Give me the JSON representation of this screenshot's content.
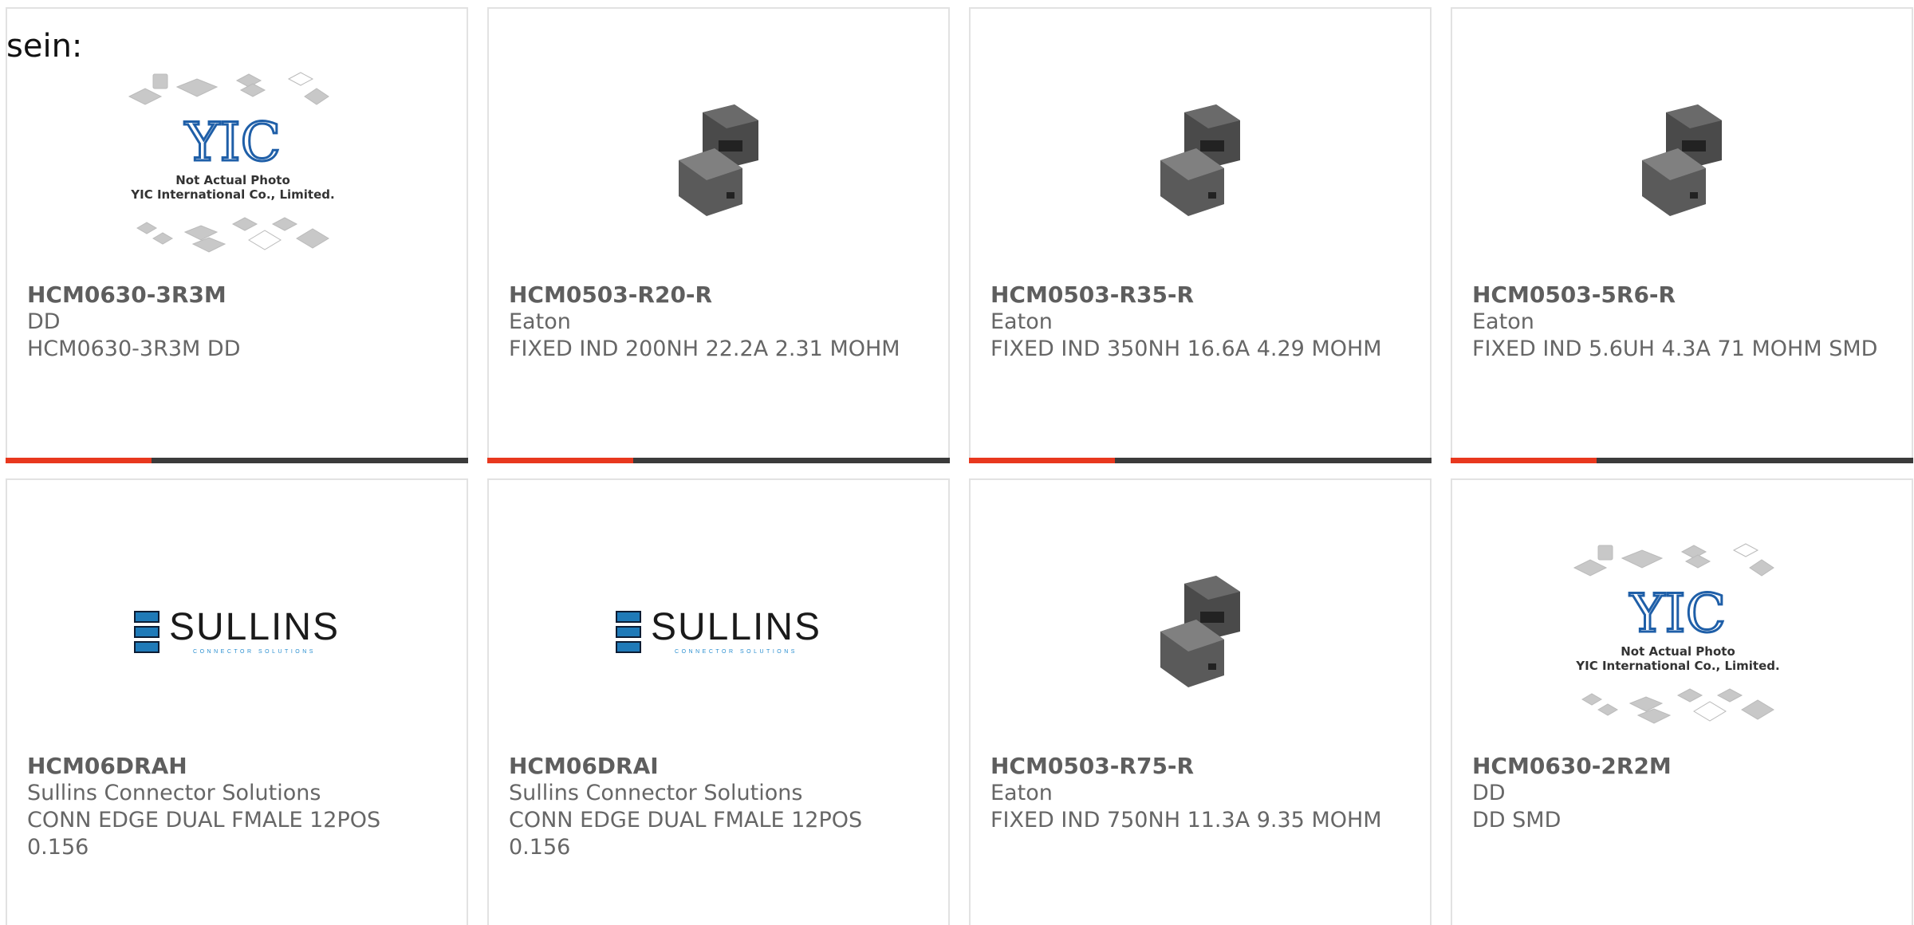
{
  "overlay_text": "sein:",
  "colors": {
    "accent": "#e8381e",
    "bar": "#3b3b3b",
    "card_border": "#e2e2e2",
    "text": "#666666"
  },
  "placeholder": {
    "line1": "Not Actual Photo",
    "line2": "YIC International Co., Limited.",
    "logo": "YIC"
  },
  "sullins_logo": {
    "name": "SULLINS",
    "tagline": "CONNECTOR SOLUTIONS"
  },
  "products": [
    {
      "part": "HCM0630-3R3M",
      "manufacturer": "DD",
      "description": "HCM0630-3R3M DD",
      "image": "yic-placeholder"
    },
    {
      "part": "HCM0503-R20-R",
      "manufacturer": "Eaton",
      "description": "FIXED IND 200NH 22.2A 2.31 MOHM",
      "image": "inductor-photo"
    },
    {
      "part": "HCM0503-R35-R",
      "manufacturer": "Eaton",
      "description": "FIXED IND 350NH 16.6A 4.29 MOHM",
      "image": "inductor-photo"
    },
    {
      "part": "HCM0503-5R6-R",
      "manufacturer": "Eaton",
      "description": "FIXED IND 5.6UH 4.3A 71 MOHM SMD",
      "image": "inductor-photo"
    },
    {
      "part": "HCM06DRAH",
      "manufacturer": "Sullins Connector Solutions",
      "description": "CONN EDGE DUAL FMALE 12POS 0.156",
      "image": "sullins-logo"
    },
    {
      "part": "HCM06DRAI",
      "manufacturer": "Sullins Connector Solutions",
      "description": "CONN EDGE DUAL FMALE 12POS 0.156",
      "image": "sullins-logo"
    },
    {
      "part": "HCM0503-R75-R",
      "manufacturer": "Eaton",
      "description": "FIXED IND 750NH 11.3A 9.35 MOHM",
      "image": "inductor-photo"
    },
    {
      "part": "HCM0630-2R2M",
      "manufacturer": "DD",
      "description": "DD SMD",
      "image": "yic-placeholder"
    }
  ]
}
